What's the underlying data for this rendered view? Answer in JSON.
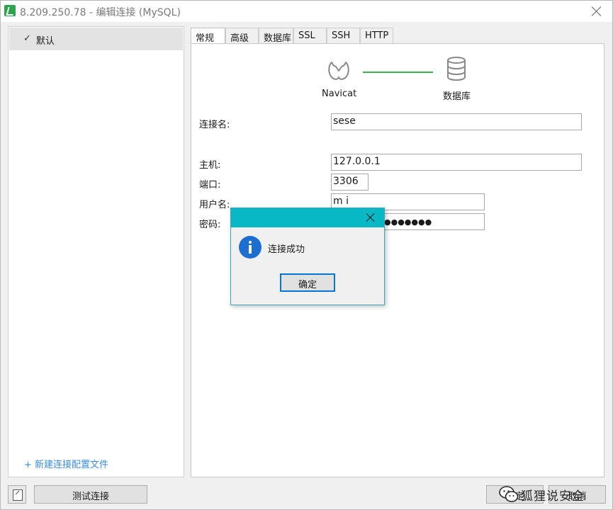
{
  "window": {
    "title": "8.209.250.78 - 编辑连接 (MySQL)"
  },
  "sidebar": {
    "profiles": [
      {
        "check": "✓",
        "label": "默认"
      }
    ],
    "new_profile_link": "+ 新建连接配置文件"
  },
  "tabs": [
    "常规",
    "高级",
    "数据库",
    "SSL",
    "SSH",
    "HTTP"
  ],
  "active_tab": "常规",
  "diagram": {
    "left_label": "Navicat",
    "right_label": "数据库",
    "line_color": "#39b54a"
  },
  "form": {
    "connection_name": {
      "label": "连接名:",
      "value": "sese"
    },
    "host": {
      "label": "主机:",
      "value": "127.0.0.1"
    },
    "port": {
      "label": "端口:",
      "value": "3306"
    },
    "username": {
      "label": "用户名:",
      "value": "m    i"
    },
    "password": {
      "label": "密码:",
      "value": "●●●●●●●"
    }
  },
  "bottom": {
    "test_button": "测试连接",
    "ok_button": "确定",
    "cancel_button": "取消"
  },
  "dialog": {
    "message": "连接成功",
    "ok_button": "确定",
    "bar_color": "#08b8c4"
  },
  "watermark": {
    "text": "狐狸说安全"
  }
}
